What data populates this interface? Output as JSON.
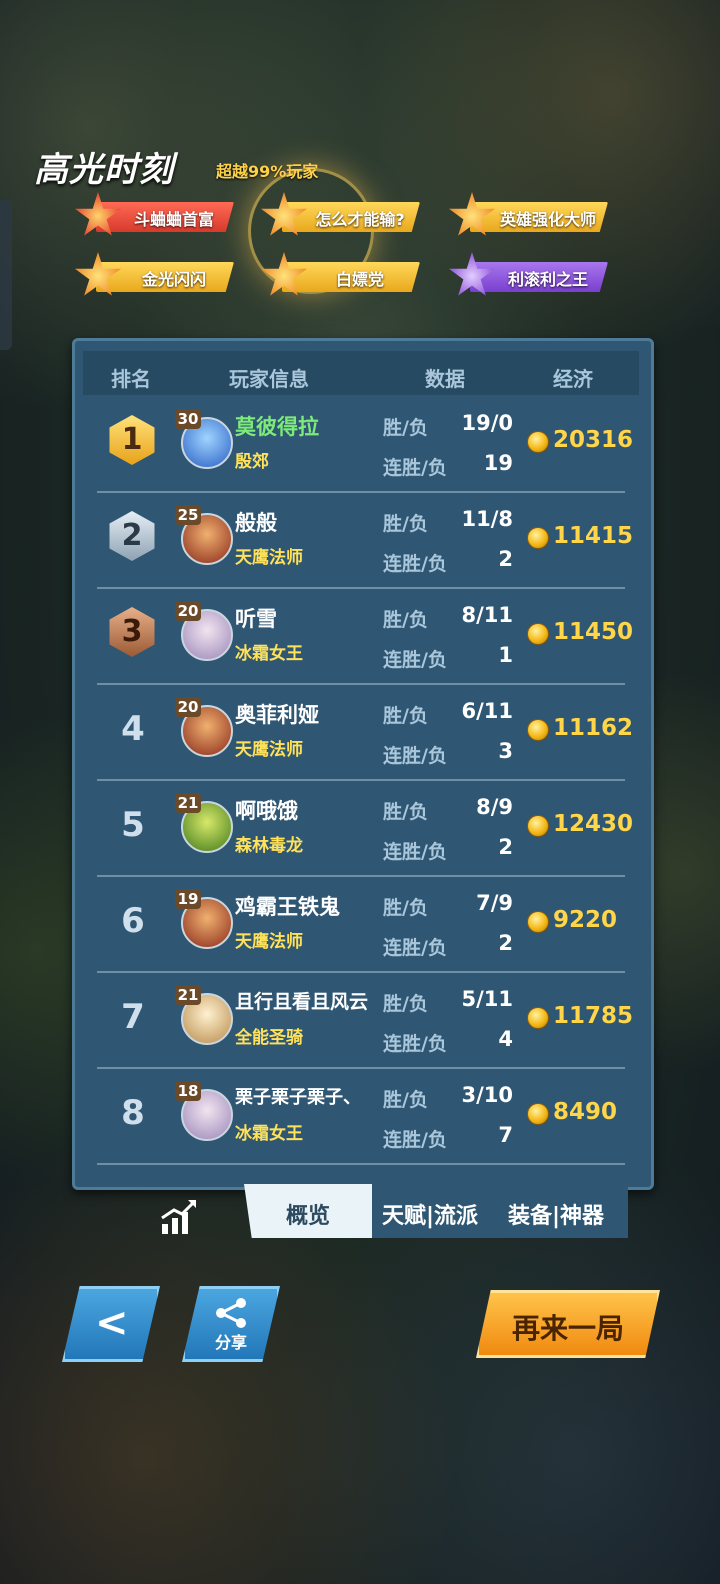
{
  "header": {
    "title": "高光时刻",
    "subtitle": "超越99%玩家"
  },
  "badges": [
    {
      "label": "斗蛐蛐首富",
      "color": "#e8473a",
      "star": "#f7a13a"
    },
    {
      "label": "怎么才能输?",
      "color": "#f2c233",
      "star": "#f08a28"
    },
    {
      "label": "英雄强化大师",
      "color": "#f2c233",
      "star": "#f08a28"
    },
    {
      "label": "金光闪闪",
      "color": "#f2c233",
      "star": "#f08a28"
    },
    {
      "label": "白嫖党",
      "color": "#f2c233",
      "star": "#f08a28"
    },
    {
      "label": "利滚利之王",
      "color": "#8f55d8",
      "star": "#b07af0"
    }
  ],
  "table": {
    "headers": {
      "rank": "排名",
      "player": "玩家信息",
      "stats": "数据",
      "economy": "经济"
    },
    "win_loss_label": "胜/负",
    "streak_label": "连胜/负",
    "rows": [
      {
        "rank": "1",
        "level": "30",
        "name": "莫彼得拉",
        "hero": "殷郊",
        "win_loss": "19/0",
        "streak": "19",
        "gold": "20316"
      },
      {
        "rank": "2",
        "level": "25",
        "name": "般般",
        "hero": "天鹰法师",
        "win_loss": "11/8",
        "streak": "2",
        "gold": "11415"
      },
      {
        "rank": "3",
        "level": "20",
        "name": "听雪",
        "hero": "冰霜女王",
        "win_loss": "8/11",
        "streak": "1",
        "gold": "11450"
      },
      {
        "rank": "4",
        "level": "20",
        "name": "奥菲利娅",
        "hero": "天鹰法师",
        "win_loss": "6/11",
        "streak": "3",
        "gold": "11162"
      },
      {
        "rank": "5",
        "level": "21",
        "name": "啊哦饿",
        "hero": "森林毒龙",
        "win_loss": "8/9",
        "streak": "2",
        "gold": "12430"
      },
      {
        "rank": "6",
        "level": "19",
        "name": "鸡霸王铁鬼",
        "hero": "天鹰法师",
        "win_loss": "7/9",
        "streak": "2",
        "gold": "9220"
      },
      {
        "rank": "7",
        "level": "21",
        "name": "且行且看且风云",
        "hero": "全能圣骑",
        "win_loss": "5/11",
        "streak": "4",
        "gold": "11785"
      },
      {
        "rank": "8",
        "level": "18",
        "name": "栗子栗子栗子、",
        "hero": "冰霜女王",
        "win_loss": "3/10",
        "streak": "7",
        "gold": "8490"
      }
    ]
  },
  "tabs": {
    "overview": "概览",
    "talent": "天赋|流派",
    "equipment": "装备|神器"
  },
  "buttons": {
    "back": "<",
    "share": "分享",
    "again": "再来一局"
  },
  "icons": {
    "chart": "trend-chart-icon",
    "share": "share-icon",
    "coin": "gold-coin-icon"
  }
}
